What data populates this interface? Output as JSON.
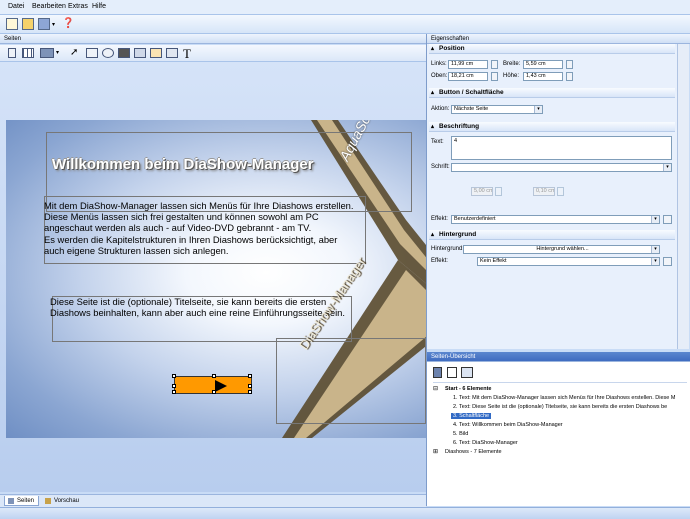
{
  "menubar": {
    "items": [
      "Datei",
      "Bearbeiten",
      "Extras",
      "Hilfe"
    ]
  },
  "left_panel": {
    "header": "Seiten",
    "bottom_tabs": [
      "Seiten",
      "Vorschau"
    ]
  },
  "slide": {
    "title": "Willkommen beim DiaShow-Manager",
    "body1": "Mit dem DiaShow-Manager lassen sich Menüs für Ihre Diashows erstellen. Diese Menüs lassen sich frei gestalten und können sowohl am PC angeschaut werden als auch - auf Video-DVD gebrannt - am TV.\nEs werden die Kapitelstrukturen in Ihren Diashows berücksichtigt, aber auch eigene Strukturen lassen sich anlegen.",
    "body2": "Diese Seite ist die (optionale) Titelseite, sie kann bereits die ersten Diashows beinhalten, kann aber auch eine reine Einführungsseite sein.",
    "logo_text": "AquaSoft",
    "band_text": "DiaShow-Manager"
  },
  "properties": {
    "header": "Eigenschaften",
    "position": {
      "title": "Position",
      "links_label": "Links:",
      "links_value": "11,99 cm",
      "breite_label": "Breite:",
      "breite_value": "5,59 cm",
      "oben_label": "Oben:",
      "oben_value": "18,21 cm",
      "hoehe_label": "Höhe:",
      "hoehe_value": "1,43 cm"
    },
    "button": {
      "title": "Button / Schaltfläche",
      "aktion_label": "Aktion:",
      "aktion_value": "Nächste Seite"
    },
    "beschriftung": {
      "title": "Beschriftung",
      "text_label": "Text:",
      "text_value": "4",
      "schrift_label": "Schrift:",
      "rand_value": "5,00 cm",
      "abstand_value": "0,10 cm",
      "effekt_label": "Effekt:",
      "effekt_value": "Benutzerdefiniert"
    },
    "hintergrund": {
      "title": "Hintergrund",
      "hintergrund_label": "Hintergrund:",
      "hintergrund_value": "Hintergrund wählen...",
      "effekt_label": "Effekt:",
      "effekt_value": "Kein Effekt"
    }
  },
  "overview": {
    "header": "Seiten-Übersicht",
    "root": "Start - 6 Elemente",
    "items": [
      "1. Text: Mit dem DiaShow-Manager lassen sich Menüs für Ihre Diashows erstellen. Diese M",
      "2. Text: Diese Seite ist die (optionale) Titelseite, sie kann bereits die ersten Diashows be",
      "3. Schaltfläche",
      "4. Text: Willkommen beim DiaShow-Manager",
      "5. Bild",
      "6. Text: DiaShow-Manager"
    ],
    "root2": "Diashows - 7 Elemente"
  }
}
